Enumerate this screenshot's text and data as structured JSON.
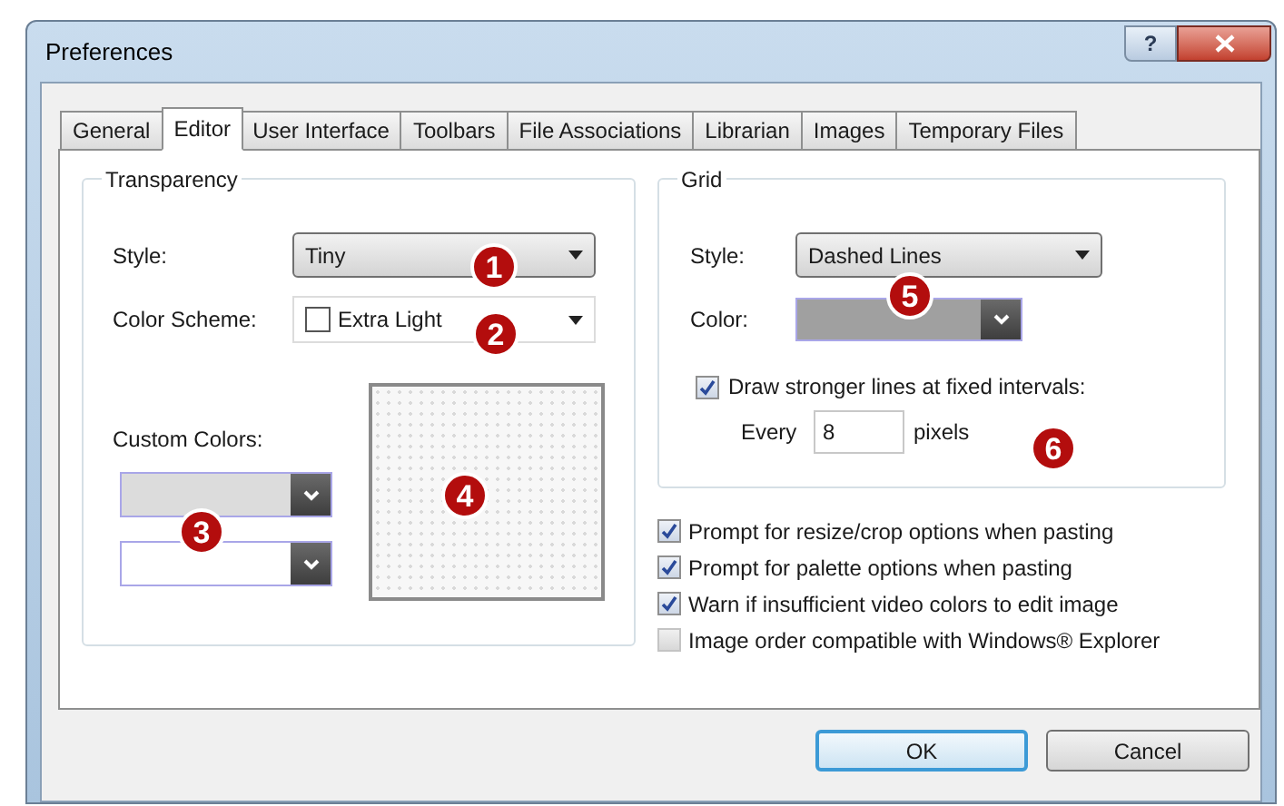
{
  "window": {
    "title": "Preferences",
    "help_button": "?"
  },
  "tabs": [
    {
      "label": "General",
      "selected": false
    },
    {
      "label": "Editor",
      "selected": true
    },
    {
      "label": "User Interface",
      "selected": false
    },
    {
      "label": "Toolbars",
      "selected": false
    },
    {
      "label": "File Associations",
      "selected": false
    },
    {
      "label": "Librarian",
      "selected": false
    },
    {
      "label": "Images",
      "selected": false
    },
    {
      "label": "Temporary Files",
      "selected": false
    }
  ],
  "transparency": {
    "title": "Transparency",
    "style": {
      "label": "Style:",
      "value": "Tiny",
      "callout": "1"
    },
    "color_scheme": {
      "label": "Color Scheme:",
      "value": "Extra Light",
      "callout": "2"
    },
    "custom_colors": {
      "label": "Custom Colors:",
      "callout": "3",
      "swatches": [
        {
          "color": "#dcdcdc"
        },
        {
          "color": "#ffffff"
        }
      ]
    },
    "preview": {
      "callout": "4"
    }
  },
  "grid": {
    "title": "Grid",
    "style": {
      "label": "Style:",
      "value": "Dashed Lines"
    },
    "color": {
      "label": "Color:",
      "color": "#a0a0a0",
      "callout": "5"
    },
    "stronger_lines": {
      "label": "Draw stronger lines at fixed intervals:",
      "checked": true
    },
    "interval": {
      "prefix": "Every",
      "value": "8",
      "suffix": "pixels",
      "callout": "6"
    }
  },
  "options": [
    {
      "label": "Prompt for resize/crop options when pasting",
      "checked": true
    },
    {
      "label": "Prompt for palette options when pasting",
      "checked": true
    },
    {
      "label": "Warn if insufficient video colors to edit image",
      "checked": true
    },
    {
      "label": "Image order compatible with Windows® Explorer",
      "checked": false
    }
  ],
  "buttons": [
    {
      "label": "OK",
      "default": true
    },
    {
      "label": "Cancel",
      "default": false
    }
  ]
}
